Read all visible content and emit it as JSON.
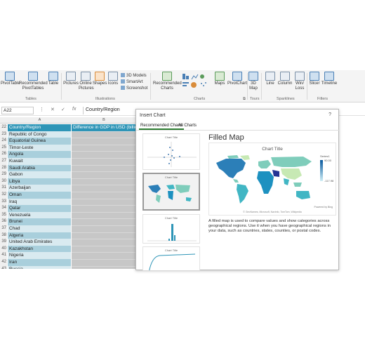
{
  "ribbon": {
    "items": [
      {
        "label": "PivotTable"
      },
      {
        "label": "Recommended PivotTables"
      },
      {
        "label": "Table"
      },
      {
        "label": "Pictures"
      },
      {
        "label": "Online Pictures"
      },
      {
        "label": "Shapes"
      },
      {
        "label": "Icons"
      },
      {
        "label": "Recommended Charts"
      },
      {
        "label": "Maps"
      },
      {
        "label": "PivotChart"
      },
      {
        "label": "3D Map"
      },
      {
        "label": "Line"
      },
      {
        "label": "Column"
      },
      {
        "label": "Win/ Loss"
      },
      {
        "label": "Slicer"
      },
      {
        "label": "Timeline"
      }
    ],
    "small_items": {
      "models": "3D Models",
      "smartart": "SmartArt",
      "screenshot": "Screenshot"
    },
    "groups": [
      "Tables",
      "Illustrations",
      "Charts",
      "Tours",
      "Sparklines",
      "Filters"
    ]
  },
  "formula_bar": {
    "name_box": "A22",
    "cancel": "✕",
    "enter": "✓",
    "fx": "fx",
    "value": "Country/Region"
  },
  "grid": {
    "columns": [
      "A",
      "B"
    ],
    "header_row": {
      "num": "22",
      "a": "Country/Region",
      "b": "Difference in GDP in USD (billions)"
    },
    "rows": [
      {
        "num": "23",
        "a": "Republic of Congo"
      },
      {
        "num": "24",
        "a": "Equatorial Guinea"
      },
      {
        "num": "25",
        "a": "Timor-Leste"
      },
      {
        "num": "26",
        "a": "Angola"
      },
      {
        "num": "27",
        "a": "Kuwait"
      },
      {
        "num": "28",
        "a": "Saudi Arabia"
      },
      {
        "num": "29",
        "a": "Gabon"
      },
      {
        "num": "30",
        "a": "Libya"
      },
      {
        "num": "31",
        "a": "Azerbaijan"
      },
      {
        "num": "32",
        "a": "Oman"
      },
      {
        "num": "33",
        "a": "Iraq"
      },
      {
        "num": "34",
        "a": "Qatar"
      },
      {
        "num": "35",
        "a": "Venezuela"
      },
      {
        "num": "36",
        "a": "Brunei"
      },
      {
        "num": "37",
        "a": "Chad"
      },
      {
        "num": "38",
        "a": "Algeria"
      },
      {
        "num": "39",
        "a": "United Arab Emirates"
      },
      {
        "num": "40",
        "a": "Kazakhstan"
      },
      {
        "num": "41",
        "a": "Nigeria"
      },
      {
        "num": "42",
        "a": "Iran"
      },
      {
        "num": "43",
        "a": "Russia"
      }
    ],
    "colors": {
      "header": "#2e95b7",
      "band_dark": "#a9cfdc",
      "band_light": "#d9eaf0",
      "col_b": "#c7c7c7"
    }
  },
  "dialog": {
    "title": "Insert Chart",
    "help": "?",
    "tabs": [
      "Recommended Charts",
      "All Charts"
    ],
    "thumbnails": [
      {
        "title": "Chart Title"
      },
      {
        "title": "Chart Title"
      },
      {
        "title": "Chart Title"
      },
      {
        "title": "Chart Title"
      }
    ],
    "preview": {
      "heading": "Filled Map",
      "chart_title": "Chart Title",
      "legend_series": "Series1",
      "legend_max": "90.00",
      "legend_min": "-117.98",
      "powered_by": "Powered by Bing",
      "attribution": "© GeoNames, Microsoft, Navinfo, TomTom, Wikipedia",
      "description": "A filled map is used to compare values and show categories across geographical regions. Use it when you have geographical regions in your data, such as countries, states, counties, or postal codes."
    }
  }
}
